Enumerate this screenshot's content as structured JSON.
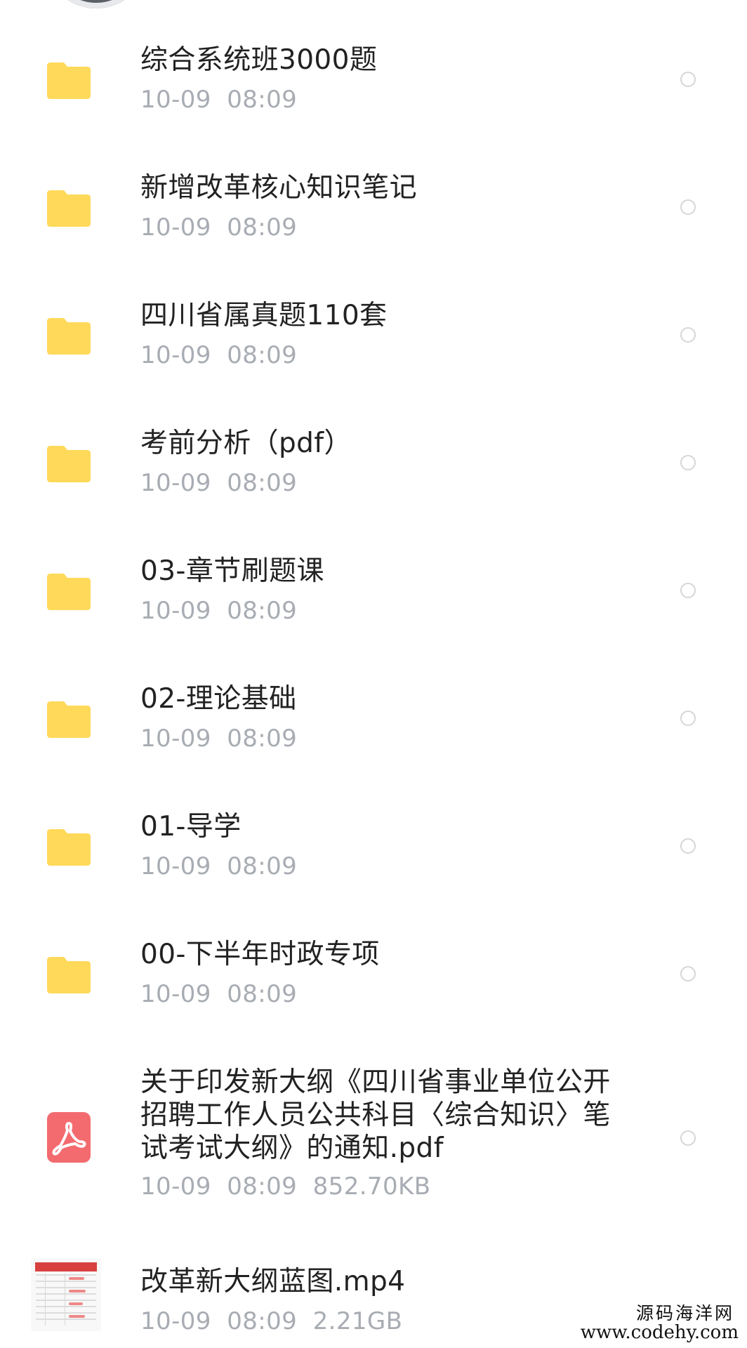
{
  "files": [
    {
      "name": "综合系统班3000题",
      "date": "10-09",
      "time": "08:09",
      "type": "folder"
    },
    {
      "name": "新增改革核心知识笔记",
      "date": "10-09",
      "time": "08:09",
      "type": "folder"
    },
    {
      "name": "四川省属真题110套",
      "date": "10-09",
      "time": "08:09",
      "type": "folder"
    },
    {
      "name": "考前分析（pdf）",
      "date": "10-09",
      "time": "08:09",
      "type": "folder"
    },
    {
      "name": "03-章节刷题课",
      "date": "10-09",
      "time": "08:09",
      "type": "folder"
    },
    {
      "name": "02-理论基础",
      "date": "10-09",
      "time": "08:09",
      "type": "folder"
    },
    {
      "name": "01-导学",
      "date": "10-09",
      "time": "08:09",
      "type": "folder"
    },
    {
      "name": "00-下半年时政专项",
      "date": "10-09",
      "time": "08:09",
      "type": "folder"
    },
    {
      "name": "关于印发新大纲《四川省事业单位公开招聘工作人员公共科目〈综合知识〉笔试考试大纲》的通知.pdf",
      "date": "10-09",
      "time": "08:09",
      "size": "852.70KB",
      "type": "pdf"
    },
    {
      "name": "改革新大纲蓝图.mp4",
      "date": "10-09",
      "time": "08:09",
      "size": "2.21GB",
      "type": "video"
    }
  ],
  "watermark": {
    "title": "源码海洋网",
    "url": "www.codehy.com"
  },
  "colors": {
    "folder": "#ffd95a",
    "pdf": "#f36b6f",
    "meta_text": "#a8acb3",
    "name_text": "#222222",
    "radio_border": "#d6d6d6"
  },
  "icons": {
    "folder": "folder-icon",
    "pdf": "pdf-file-icon",
    "video": "video-thumbnail-icon",
    "select": "radio-unchecked-icon"
  }
}
